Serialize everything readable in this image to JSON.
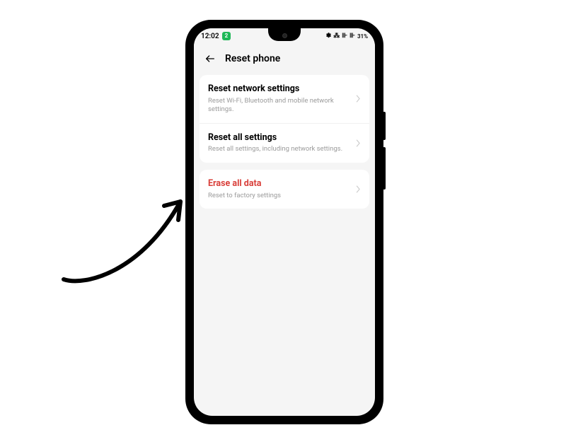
{
  "status": {
    "time": "12:02",
    "sim_badge": "2",
    "battery_text": "31%"
  },
  "header": {
    "title": "Reset phone"
  },
  "groups": [
    {
      "items": [
        {
          "title": "Reset network settings",
          "subtitle": "Reset Wi-Fi, Bluetooth and mobile network settings.",
          "danger": false
        },
        {
          "title": "Reset all settings",
          "subtitle": "Reset all settings, including network settings.",
          "danger": false
        }
      ]
    },
    {
      "items": [
        {
          "title": "Erase all data",
          "subtitle": "Reset to factory settings",
          "danger": true
        }
      ]
    }
  ]
}
